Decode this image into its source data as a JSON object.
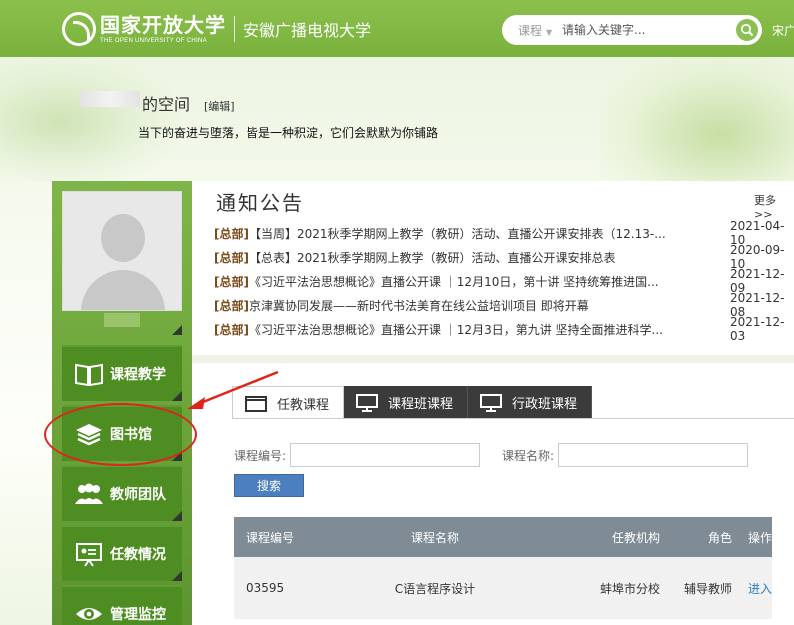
{
  "header": {
    "logo_cn": "国家开放大学",
    "logo_en": "THE OPEN UNIVERSITY OF CHINA",
    "sub_school": "安徽广播电视大学",
    "search_category": "课程",
    "search_placeholder": "请输入关键字...",
    "user_name": "宋广",
    "brand_color": "#7bb33f"
  },
  "banner": {
    "space_title": "的空间",
    "edit_label": "[编辑]",
    "motto": "当下的奋进与堕落，皆是一种积淀，它们会默默为你铺路"
  },
  "sidebar": {
    "items": [
      {
        "label": "课程教学",
        "icon": "book-icon"
      },
      {
        "label": "图书馆",
        "icon": "layers-icon"
      },
      {
        "label": "教师团队",
        "icon": "team-icon"
      },
      {
        "label": "任教情况",
        "icon": "presentation-icon"
      },
      {
        "label": "管理监控",
        "icon": "eye-icon"
      }
    ]
  },
  "notices": {
    "title": "通知公告",
    "more": "更多>>",
    "items": [
      {
        "src": "[总部]",
        "text": "【当周】2021秋季学期网上教学（教研）活动、直播公开课安排表（12.13-...",
        "date": "2021-04-10"
      },
      {
        "src": "[总部]",
        "text": "【总表】2021秋季学期网上教学（教研）活动、直播公开课安排总表",
        "date": "2020-09-10"
      },
      {
        "src": "[总部]",
        "text": "《习近平法治思想概论》直播公开课 ｜12月10日，第十讲 坚持统筹推进国...",
        "date": "2021-12-09"
      },
      {
        "src": "[总部]",
        "text": "京津冀协同发展——新时代书法美育在线公益培训项目 即将开幕",
        "date": "2021-12-08"
      },
      {
        "src": "[总部]",
        "text": "《习近平法治思想概论》直播公开课 ｜12月3日，第九讲 坚持全面推进科学...",
        "date": "2021-12-03"
      }
    ]
  },
  "tabs": [
    {
      "label": "任教课程"
    },
    {
      "label": "课程班课程"
    },
    {
      "label": "行政班课程"
    }
  ],
  "form": {
    "code_label": "课程编号:",
    "name_label": "课程名称:",
    "submit": "搜索"
  },
  "table": {
    "headers": [
      "课程编号",
      "课程名称",
      "任教机构",
      "角色",
      "操作"
    ],
    "rows": [
      {
        "code": "03595",
        "name": "C语言程序设计",
        "org": "蚌埠市分校",
        "role": "辅导教师",
        "action": "进入"
      }
    ]
  }
}
